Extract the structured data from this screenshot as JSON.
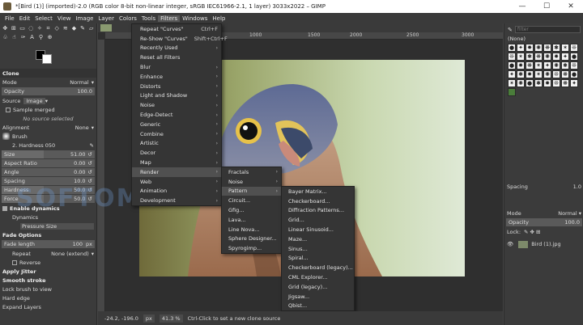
{
  "window": {
    "title": "*[Bird (1)] (imported)-2.0 (RGB color 8-bit non-linear integer, sRGB IEC61966-2.1, 1 layer) 3033x2022 – GIMP",
    "minimize": "—",
    "maximize": "☐",
    "close": "✕"
  },
  "menubar": [
    "File",
    "Edit",
    "Select",
    "View",
    "Image",
    "Layer",
    "Colors",
    "Tools",
    "Filters",
    "Windows",
    "Help"
  ],
  "tool_options": {
    "title": "Clone",
    "mode_label": "Mode",
    "mode_value": "Normal",
    "opacity_label": "Opacity",
    "opacity_value": "100.0",
    "source_label": "Source",
    "source_value": "Image",
    "sample_merged": "Sample merged",
    "no_source": "No source selected",
    "alignment_label": "Alignment",
    "alignment_value": "None",
    "brush_label": "Brush",
    "brush_value": "2. Hardness 050",
    "size_label": "Size",
    "size_value": "51.00",
    "aspect_label": "Aspect Ratio",
    "aspect_value": "0.00",
    "angle_label": "Angle",
    "angle_value": "0.00",
    "spacing_label": "Spacing",
    "spacing_value": "10.0",
    "hardness_label": "Hardness",
    "hardness_value": "50.0",
    "force_label": "Force",
    "force_value": "50.0",
    "enable_dynamics": "Enable dynamics",
    "dynamics_label": "Dynamics",
    "dynamics_value": "Pressure Size",
    "fade_options": "Fade Options",
    "fade_length_label": "Fade length",
    "fade_length_value": "100",
    "fade_unit": "px",
    "repeat_label": "Repeat",
    "repeat_value": "None (extend)",
    "reverse": "Reverse",
    "apply_jitter": "Apply Jitter",
    "smooth_stroke": "Smooth stroke",
    "lock_brush": "Lock brush to view",
    "hard_edge": "Hard edge",
    "expand_layers": "Expand Layers"
  },
  "ruler_ticks": [
    "1000",
    "1500",
    "2000",
    "2500",
    "3000"
  ],
  "filters_menu": [
    {
      "label": "Repeat \"Curves\"",
      "shortcut": "Ctrl+F"
    },
    {
      "label": "Re-Show \"Curves\"",
      "shortcut": "Shift+Ctrl+F"
    },
    {
      "label": "Recently Used",
      "arrow": "›"
    },
    {
      "label": "Reset all Filters"
    },
    {
      "label": "Blur",
      "arrow": "›"
    },
    {
      "label": "Enhance",
      "arrow": "›"
    },
    {
      "label": "Distorts",
      "arrow": "›"
    },
    {
      "label": "Light and Shadow",
      "arrow": "›"
    },
    {
      "label": "Noise",
      "arrow": "›"
    },
    {
      "label": "Edge-Detect",
      "arrow": "›"
    },
    {
      "label": "Generic",
      "arrow": "›"
    },
    {
      "label": "Combine",
      "arrow": "›"
    },
    {
      "label": "Artistic",
      "arrow": "›"
    },
    {
      "label": "Decor",
      "arrow": "›"
    },
    {
      "label": "Map",
      "arrow": "›"
    },
    {
      "label": "Render",
      "arrow": "›"
    },
    {
      "label": "Web",
      "arrow": "›"
    },
    {
      "label": "Animation",
      "arrow": "›"
    },
    {
      "label": "Development",
      "arrow": "›"
    }
  ],
  "render_menu": [
    {
      "label": "Fractals",
      "arrow": "›"
    },
    {
      "label": "Noise",
      "arrow": "›"
    },
    {
      "label": "Pattern",
      "arrow": "›"
    },
    {
      "label": "Circuit..."
    },
    {
      "label": "Gfig..."
    },
    {
      "label": "Lava..."
    },
    {
      "label": "Line Nova..."
    },
    {
      "label": "Sphere Designer..."
    },
    {
      "label": "Spyrogimp..."
    }
  ],
  "pattern_menu": [
    "Bayer Matrix...",
    "Checkerboard...",
    "Diffraction Patterns...",
    "Grid...",
    "Linear Sinusoid...",
    "Maze...",
    "Sinus...",
    "Spiral...",
    "Checkerboard (legacy)...",
    "CML Explorer...",
    "Grid (legacy)...",
    "Jigsaw...",
    "Qbist..."
  ],
  "right_panel": {
    "filter_placeholder": "filter",
    "brush_name": "(None)",
    "brush_icons": [
      "●",
      "✦",
      "✸",
      "✺",
      "❋",
      "✱",
      "✶",
      "❊"
    ],
    "spacing_label": "Spacing",
    "spacing_value": "1.0",
    "mode_label": "Mode",
    "mode_value": "Normal",
    "opacity_label": "Opacity",
    "opacity_value": "100.0",
    "lock_label": "Lock:",
    "layer_name": "Bird (1).jpg"
  },
  "status": {
    "coords": "-24.2, -196.0",
    "unit": "px",
    "zoom": "41.3 %",
    "message": "Ctrl-Click to set a new clone source"
  },
  "watermark": "SOFTOMODA",
  "colors": {
    "accent": "#505050",
    "menu_bg": "#353535"
  }
}
